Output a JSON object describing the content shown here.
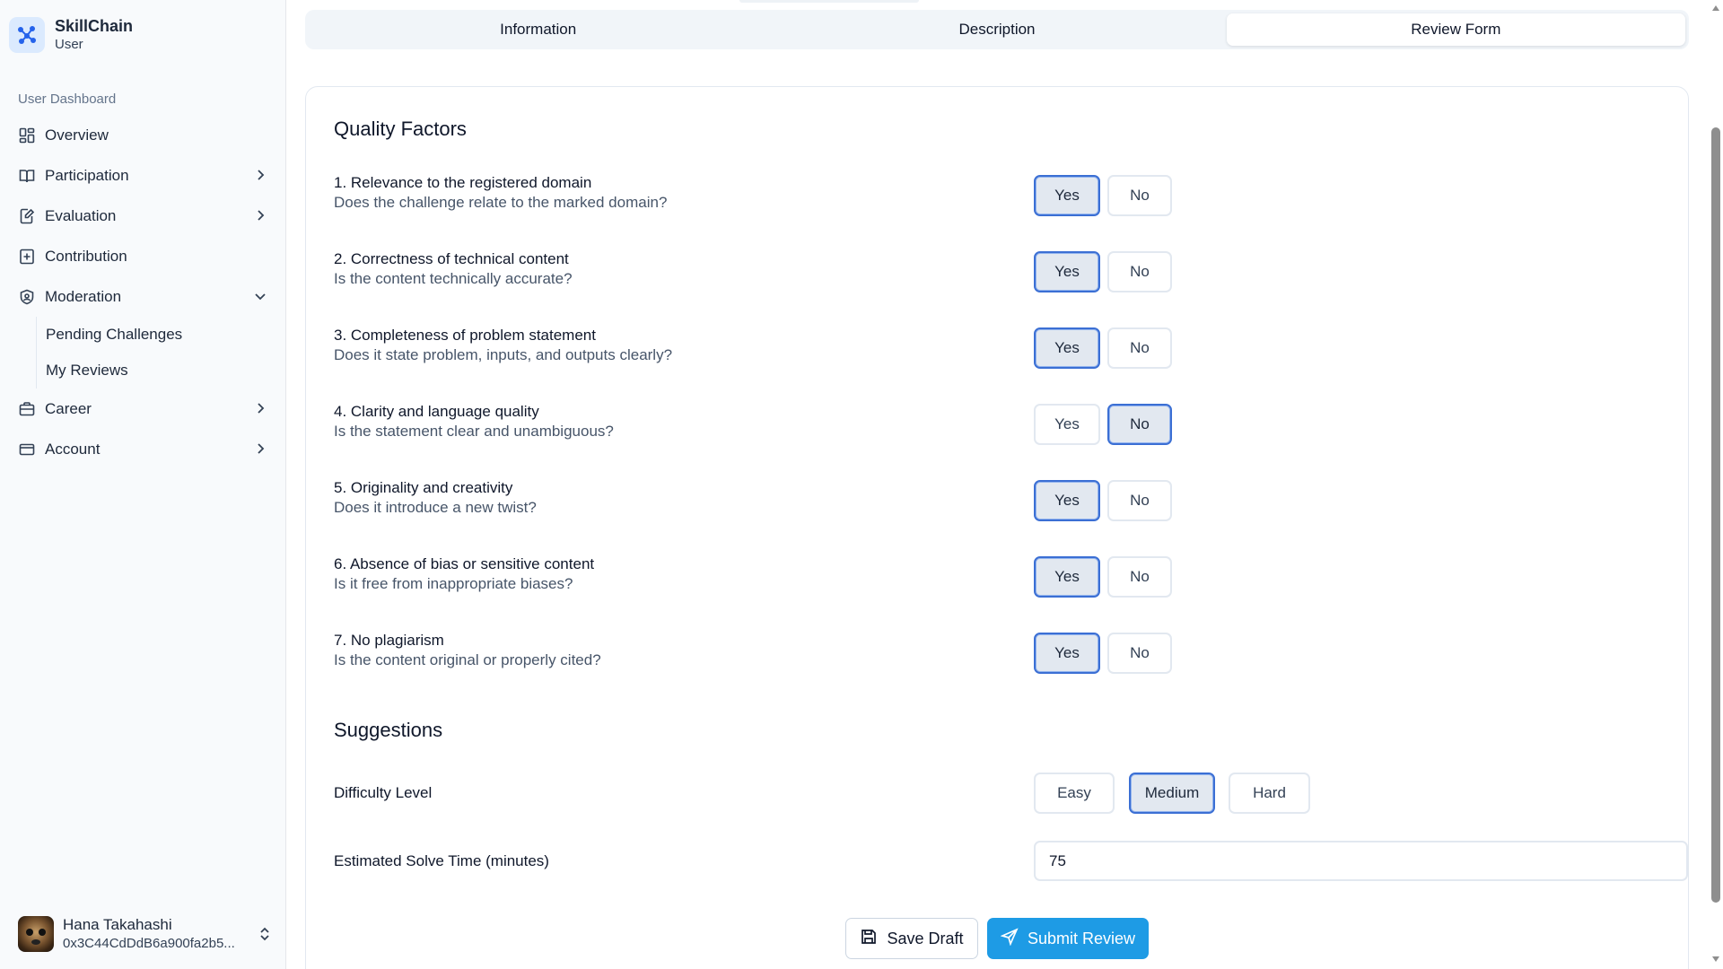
{
  "app": {
    "name": "SkillChain",
    "role": "User"
  },
  "sidebar": {
    "group_label": "User Dashboard",
    "items": [
      {
        "label": "Overview",
        "icon": "layout-grid-icon",
        "chevron": "none"
      },
      {
        "label": "Participation",
        "icon": "book-open-icon",
        "chevron": "right"
      },
      {
        "label": "Evaluation",
        "icon": "file-edit-icon",
        "chevron": "right"
      },
      {
        "label": "Contribution",
        "icon": "square-plus-icon",
        "chevron": "none"
      },
      {
        "label": "Moderation",
        "icon": "shield-icon",
        "chevron": "down"
      },
      {
        "label": "Career",
        "icon": "briefcase-icon",
        "chevron": "right"
      },
      {
        "label": "Account",
        "icon": "credit-card-icon",
        "chevron": "right"
      }
    ],
    "moderation_sub": [
      "Pending Challenges",
      "My Reviews"
    ]
  },
  "user": {
    "name": "Hana Takahashi",
    "address": "0x3C44CdDdB6a900fa2b5..."
  },
  "tabs": [
    {
      "label": "Information",
      "active": false
    },
    {
      "label": "Description",
      "active": false
    },
    {
      "label": "Review Form",
      "active": true
    }
  ],
  "quality": {
    "title": "Quality Factors",
    "yes_label": "Yes",
    "no_label": "No",
    "factors": [
      {
        "title": "1. Relevance to the registered domain",
        "desc": "Does the challenge relate to the marked domain?",
        "selected": "yes"
      },
      {
        "title": "2. Correctness of technical content",
        "desc": "Is the content technically accurate?",
        "selected": "yes"
      },
      {
        "title": "3. Completeness of problem statement",
        "desc": "Does it state problem, inputs, and outputs clearly?",
        "selected": "yes"
      },
      {
        "title": "4. Clarity and language quality",
        "desc": "Is the statement clear and unambiguous?",
        "selected": "no"
      },
      {
        "title": "5. Originality and creativity",
        "desc": "Does it introduce a new twist?",
        "selected": "yes"
      },
      {
        "title": "6. Absence of bias or sensitive content",
        "desc": "Is it free from inappropriate biases?",
        "selected": "yes"
      },
      {
        "title": "7. No plagiarism",
        "desc": "Is the content original or properly cited?",
        "selected": "yes"
      }
    ]
  },
  "suggestions": {
    "title": "Suggestions",
    "difficulty_label": "Difficulty Level",
    "difficulty_options": [
      "Easy",
      "Medium",
      "Hard"
    ],
    "difficulty_selected": "Medium",
    "time_label": "Estimated Solve Time (minutes)",
    "time_value": "75"
  },
  "actions": {
    "save_label": "Save Draft",
    "submit_label": "Submit Review"
  },
  "colors": {
    "accent": "#3b6fd4",
    "submit": "#1e9be5",
    "brand_bg": "#dbeafe"
  }
}
